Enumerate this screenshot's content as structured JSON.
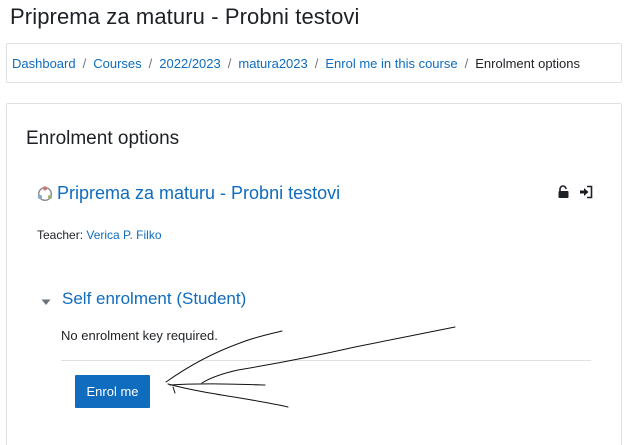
{
  "page": {
    "title": "Priprema za maturu - Probni testovi"
  },
  "breadcrumb": {
    "items": [
      {
        "label": "Dashboard"
      },
      {
        "label": "Courses"
      },
      {
        "label": "2022/2023"
      },
      {
        "label": "matura2023"
      },
      {
        "label": "Enrol me in this course"
      }
    ],
    "current": "Enrolment options",
    "separator": "/"
  },
  "enrolment": {
    "heading": "Enrolment options",
    "course": {
      "name": "Priprema za maturu - Probni testovi",
      "icon": "course-icon",
      "enrol_icons": [
        "unlock-icon",
        "sign-in-icon"
      ]
    },
    "teacher": {
      "label": "Teacher:",
      "name": "Verica P. Filko"
    },
    "section": {
      "title": "Self enrolment (Student)",
      "toggle_icon": "caret-down-icon",
      "message": "No enrolment key required.",
      "button_label": "Enrol me"
    }
  },
  "colors": {
    "link": "#0f6cbf",
    "text": "#1d2125",
    "border": "#dee2e6",
    "button": "#0f6cbf"
  }
}
